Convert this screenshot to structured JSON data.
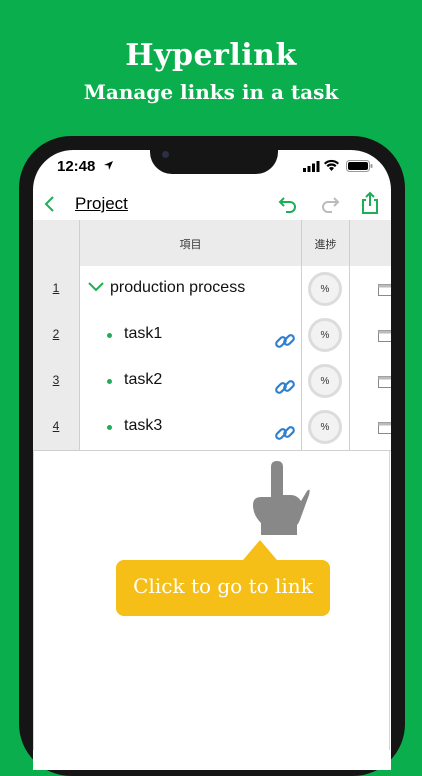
{
  "promo": {
    "title": "Hyperlink",
    "subtitle": "Manage links in a task"
  },
  "status_bar": {
    "time": "12:48"
  },
  "nav": {
    "title": "Project"
  },
  "table": {
    "headers": {
      "item": "項目",
      "progress": "進捗"
    },
    "rows": [
      {
        "num": "1",
        "name": "production process",
        "progress": "%",
        "kind": "group"
      },
      {
        "num": "2",
        "name": "task1",
        "progress": "%",
        "kind": "task"
      },
      {
        "num": "3",
        "name": "task2",
        "progress": "%",
        "kind": "task"
      },
      {
        "num": "4",
        "name": "task3",
        "progress": "%",
        "kind": "task"
      }
    ]
  },
  "callout": {
    "text": "Click to go to link"
  },
  "colors": {
    "background": "#0aae4c",
    "accent": "#1eae55",
    "link": "#2e7fd0",
    "callout": "#f6bf17"
  },
  "icons": [
    "location-arrow-icon",
    "signal-icon",
    "wifi-icon",
    "battery-icon",
    "back-chevron-icon",
    "undo-icon",
    "redo-icon",
    "share-icon",
    "chevron-down-icon",
    "link-icon",
    "calendar-icon",
    "pointing-hand-icon"
  ]
}
